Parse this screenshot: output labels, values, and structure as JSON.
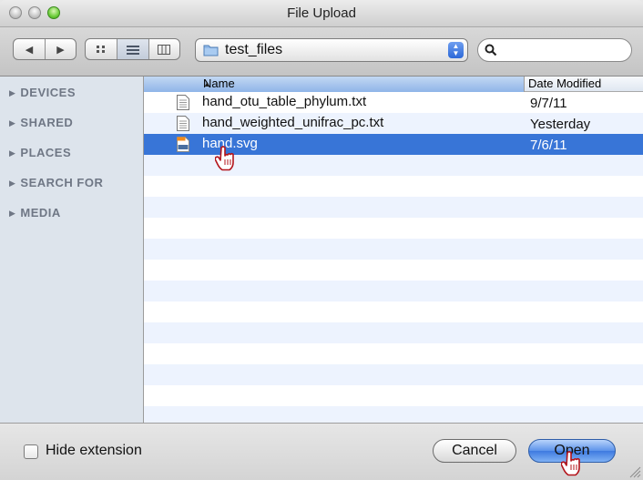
{
  "window": {
    "title": "File Upload"
  },
  "toolbar": {
    "back_symbol": "◀",
    "forward_symbol": "▶",
    "location": "test_files",
    "search": {
      "value": "",
      "placeholder": ""
    }
  },
  "sidebar": {
    "sections": [
      "DEVICES",
      "SHARED",
      "PLACES",
      "SEARCH FOR",
      "MEDIA"
    ]
  },
  "file_list": {
    "columns": {
      "name": "Name",
      "date": "Date Modified",
      "sort_indicator": "▲"
    },
    "files": [
      {
        "name": "hand_otu_table_phylum.txt",
        "date": "9/7/11",
        "icon": "text-file-icon",
        "selected": false
      },
      {
        "name": "hand_weighted_unifrac_pc.txt",
        "date": "Yesterday",
        "icon": "text-file-icon",
        "selected": false
      },
      {
        "name": "hand.svg",
        "date": "7/6/11",
        "icon": "svg-file-icon",
        "selected": true
      }
    ]
  },
  "footer": {
    "hide_extension_label": "Hide extension",
    "hide_extension_checked": false,
    "cancel_label": "Cancel",
    "open_label": "Open"
  },
  "colors": {
    "selection": "#3875d7",
    "sidebar": "#dde4ec",
    "stripe": "#edf3fe"
  }
}
